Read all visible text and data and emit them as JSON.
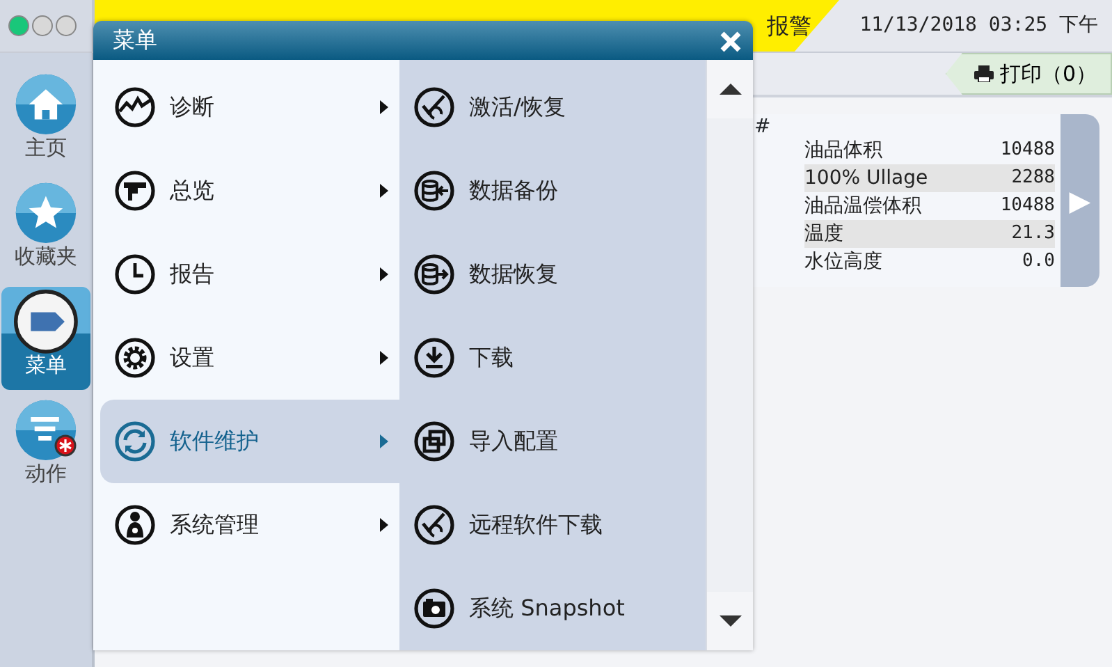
{
  "window_controls": [
    {
      "color": "#19c77a"
    },
    {
      "color": "#d8d8d8"
    },
    {
      "color": "#d8d8d8"
    }
  ],
  "alarm_banner": {
    "label": "报警"
  },
  "datetime": "11/13/2018 03:25 下午",
  "print_button": {
    "label": "打印（0）"
  },
  "sidebar": {
    "items": [
      {
        "label": "主页",
        "selected": false,
        "badge": false
      },
      {
        "label": "收藏夹",
        "selected": false,
        "badge": false
      },
      {
        "label": "菜单",
        "selected": true,
        "badge": false
      },
      {
        "label": "动作",
        "selected": false,
        "badge": true
      }
    ]
  },
  "tank_panel": {
    "header": "#",
    "rows": [
      {
        "label": "油品体积",
        "value": "10488"
      },
      {
        "label": "100% Ullage",
        "value": "2288"
      },
      {
        "label": "油品温偿体积",
        "value": "10488"
      },
      {
        "label": "温度",
        "value": "21.3"
      },
      {
        "label": "水位高度",
        "value": "0.0"
      }
    ],
    "next_arrow": "▶"
  },
  "menu": {
    "title": "菜单",
    "categories": [
      {
        "label": "诊断",
        "selected": false
      },
      {
        "label": "总览",
        "selected": false
      },
      {
        "label": "报告",
        "selected": false
      },
      {
        "label": "设置",
        "selected": false
      },
      {
        "label": "软件维护",
        "selected": true
      },
      {
        "label": "系统管理",
        "selected": false
      }
    ],
    "submenu": [
      {
        "label": "激活/恢复"
      },
      {
        "label": "数据备份"
      },
      {
        "label": "数据恢复"
      },
      {
        "label": "下载"
      },
      {
        "label": "导入配置"
      },
      {
        "label": "远程软件下载"
      },
      {
        "label": "系统 Snapshot"
      }
    ]
  }
}
